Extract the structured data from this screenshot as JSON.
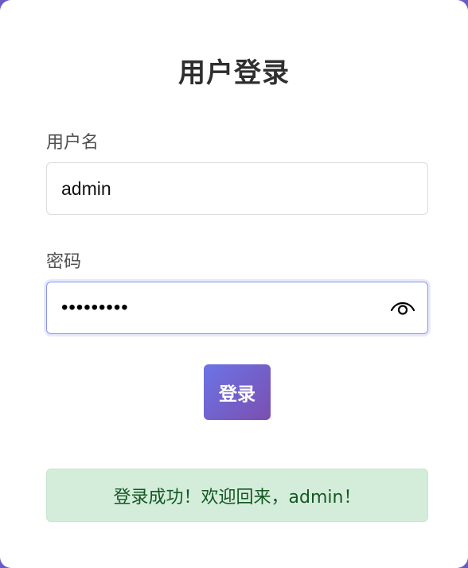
{
  "page": {
    "title": "用户登录"
  },
  "form": {
    "username": {
      "label": "用户名",
      "value": "admin"
    },
    "password": {
      "label": "密码",
      "masked_value": "•••••••••",
      "toggle_icon": "eye-icon"
    },
    "submit_label": "登录"
  },
  "status": {
    "message": "登录成功！欢迎回来，admin！",
    "type": "success"
  },
  "colors": {
    "background": "#6a5ac8",
    "button_gradient_start": "#6b74e6",
    "button_gradient_end": "#7b4fb0",
    "success_bg": "#d4edda",
    "success_text": "#155724",
    "focus_border": "#8b95e8"
  }
}
